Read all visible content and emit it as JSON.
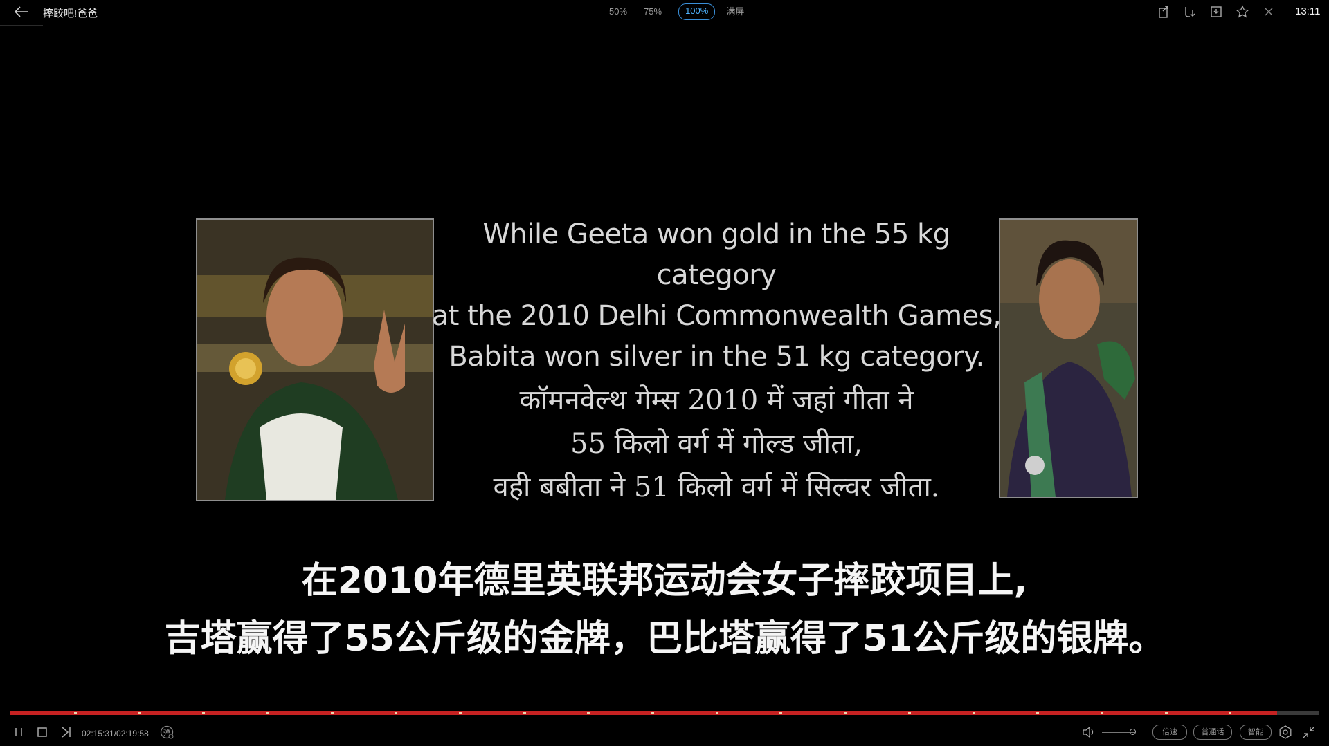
{
  "window": {
    "title": "摔跤吧!爸爸",
    "clock": "13:11"
  },
  "zoom_options": [
    "50%",
    "75%",
    "100%",
    "满屏"
  ],
  "zoom_selected": "100%",
  "toolbar_icons": [
    "share-icon",
    "download-queue-icon",
    "save-icon",
    "star-icon",
    "close-icon"
  ],
  "video": {
    "english_lines": [
      "While Geeta won gold in the 55 kg category",
      "at the 2010 Delhi Commonwealth Games,",
      "Babita won silver in the 51 kg category."
    ],
    "hindi_lines": [
      "कॉमनवेल्थ गेम्स 2010 में जहां गीता ने",
      "55 किलो वर्ग में गोल्ड जीता,",
      "वही  बबीता ने 51 किलो वर्ग में सिल्वर जीता."
    ],
    "subtitle_lines": [
      "在2010年德里英联邦运动会女子摔跤项目上,",
      "吉塔赢得了55公斤级的金牌，巴比塔赢得了51公斤级的银牌。"
    ]
  },
  "playback": {
    "time": "02:15:31/02:19:58",
    "progress_fraction": 0.968,
    "danmaku_icon": "弹",
    "speed_label": "倍速",
    "quality_label": "普通话",
    "smart_label": "智能"
  },
  "colors": {
    "accent": "#4fb3ff",
    "progress": "#c62222",
    "background": "#000000"
  }
}
